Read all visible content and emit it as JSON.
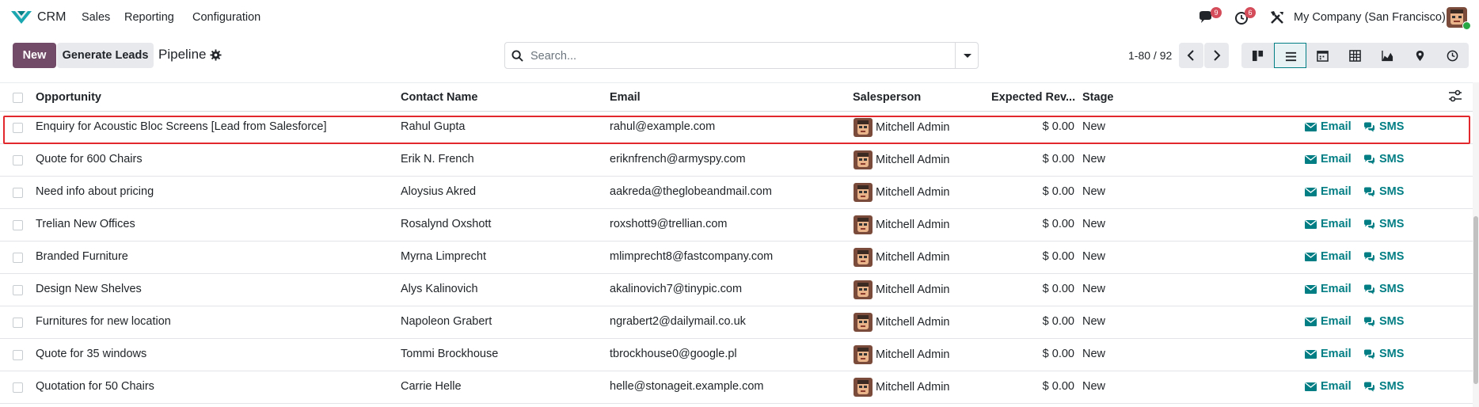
{
  "navbar": {
    "app_name": "CRM",
    "menu": [
      "Sales",
      "Reporting",
      "Configuration"
    ],
    "messages_count": "9",
    "activities_count": "6",
    "company": "My Company (San Francisco)"
  },
  "control_panel": {
    "new_label": "New",
    "generate_label": "Generate Leads",
    "title": "Pipeline",
    "search_placeholder": "Search...",
    "pager": "1-80 / 92"
  },
  "table": {
    "columns": [
      "Opportunity",
      "Contact Name",
      "Email",
      "Salesperson",
      "Expected Rev...",
      "Stage"
    ],
    "action_email": "Email",
    "action_sms": "SMS",
    "rows": [
      {
        "opportunity": "Enquiry for Acoustic Bloc Screens [Lead from Salesforce]",
        "contact": "Rahul Gupta",
        "email": "rahul@example.com",
        "salesperson": "Mitchell Admin",
        "revenue": "$ 0.00",
        "stage": "New"
      },
      {
        "opportunity": "Quote for 600 Chairs",
        "contact": "Erik N. French",
        "email": "eriknfrench@armyspy.com",
        "salesperson": "Mitchell Admin",
        "revenue": "$ 0.00",
        "stage": "New"
      },
      {
        "opportunity": "Need info about pricing",
        "contact": "Aloysius Akred",
        "email": "aakreda@theglobeandmail.com",
        "salesperson": "Mitchell Admin",
        "revenue": "$ 0.00",
        "stage": "New"
      },
      {
        "opportunity": "Trelian New Offices",
        "contact": "Rosalynd Oxshott",
        "email": "roxshott9@trellian.com",
        "salesperson": "Mitchell Admin",
        "revenue": "$ 0.00",
        "stage": "New"
      },
      {
        "opportunity": "Branded Furniture",
        "contact": "Myrna Limprecht",
        "email": "mlimprecht8@fastcompany.com",
        "salesperson": "Mitchell Admin",
        "revenue": "$ 0.00",
        "stage": "New"
      },
      {
        "opportunity": "Design New Shelves",
        "contact": "Alys Kalinovich",
        "email": "akalinovich7@tinypic.com",
        "salesperson": "Mitchell Admin",
        "revenue": "$ 0.00",
        "stage": "New"
      },
      {
        "opportunity": "Furnitures for new location",
        "contact": "Napoleon Grabert",
        "email": "ngrabert2@dailymail.co.uk",
        "salesperson": "Mitchell Admin",
        "revenue": "$ 0.00",
        "stage": "New"
      },
      {
        "opportunity": "Quote for 35 windows",
        "contact": "Tommi Brockhouse",
        "email": "tbrockhouse0@google.pl",
        "salesperson": "Mitchell Admin",
        "revenue": "$ 0.00",
        "stage": "New"
      },
      {
        "opportunity": "Quotation for 50 Chairs",
        "contact": "Carrie Helle",
        "email": "helle@stonageit.example.com",
        "salesperson": "Mitchell Admin",
        "revenue": "$ 0.00",
        "stage": "New"
      }
    ]
  },
  "colors": {
    "brand": "#714b67",
    "accent": "#017e84",
    "highlight": "#e2282c"
  }
}
